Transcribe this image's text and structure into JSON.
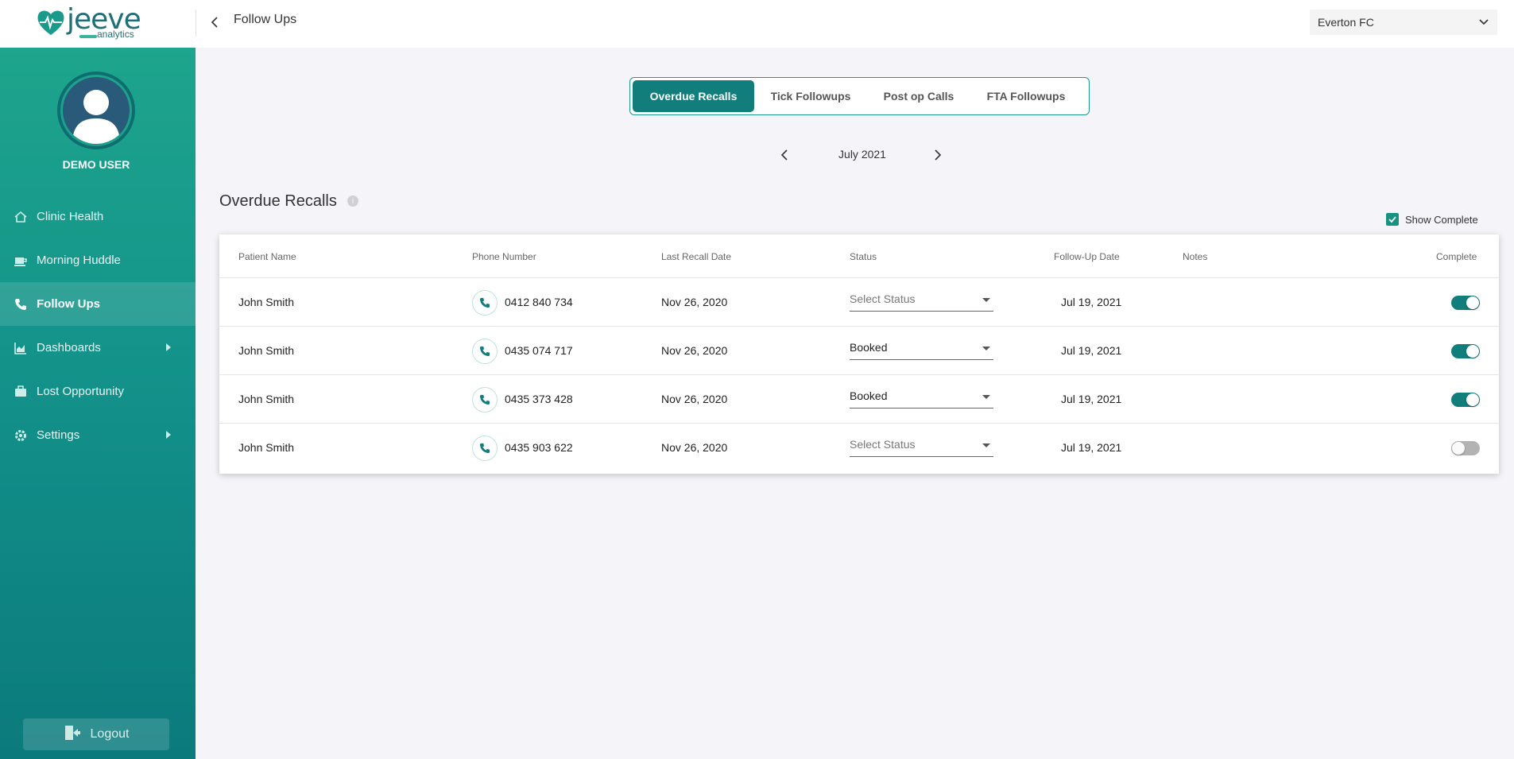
{
  "brand": {
    "name": "jeeve",
    "sub": "analytics"
  },
  "header": {
    "title": "Follow Ups",
    "clinic": "Everton FC"
  },
  "user": {
    "name": "DEMO USER"
  },
  "nav": [
    {
      "label": "Clinic Health",
      "icon": "home-icon"
    },
    {
      "label": "Morning Huddle",
      "icon": "coffee-icon"
    },
    {
      "label": "Follow Ups",
      "icon": "phone-icon"
    },
    {
      "label": "Dashboards",
      "icon": "chart-icon"
    },
    {
      "label": "Lost Opportunity",
      "icon": "briefcase-icon"
    },
    {
      "label": "Settings",
      "icon": "gear-icon"
    }
  ],
  "logout": "Logout",
  "tabs": [
    "Overdue Recalls",
    "Tick Followups",
    "Post op Calls",
    "FTA Followups"
  ],
  "month": "July 2021",
  "section": {
    "title": "Overdue Recalls",
    "show_complete": "Show Complete",
    "info": "i"
  },
  "table": {
    "headers": [
      "Patient Name",
      "Phone Number",
      "Last Recall Date",
      "Status",
      "Follow-Up Date",
      "Notes",
      "Complete"
    ],
    "rows": [
      {
        "name": "John Smith",
        "phone": "0412 840 734",
        "recall": "Nov 26, 2020",
        "status": "Select Status",
        "followup": "Jul 19, 2021",
        "notes": "",
        "complete": true
      },
      {
        "name": "John Smith",
        "phone": "0435 074 717",
        "recall": "Nov 26, 2020",
        "status": "Booked",
        "followup": "Jul 19, 2021",
        "notes": "",
        "complete": true
      },
      {
        "name": "John Smith",
        "phone": "0435 373 428",
        "recall": "Nov 26, 2020",
        "status": "Booked",
        "followup": "Jul 19, 2021",
        "notes": "",
        "complete": true
      },
      {
        "name": "John Smith",
        "phone": "0435 903 622",
        "recall": "Nov 26, 2020",
        "status": "Select Status",
        "followup": "Jul 19, 2021",
        "notes": "",
        "complete": false
      }
    ]
  },
  "colors": {
    "accent": "#117e7c",
    "sidebar_top": "#1ea58d",
    "sidebar_bottom": "#0b7a7c"
  }
}
